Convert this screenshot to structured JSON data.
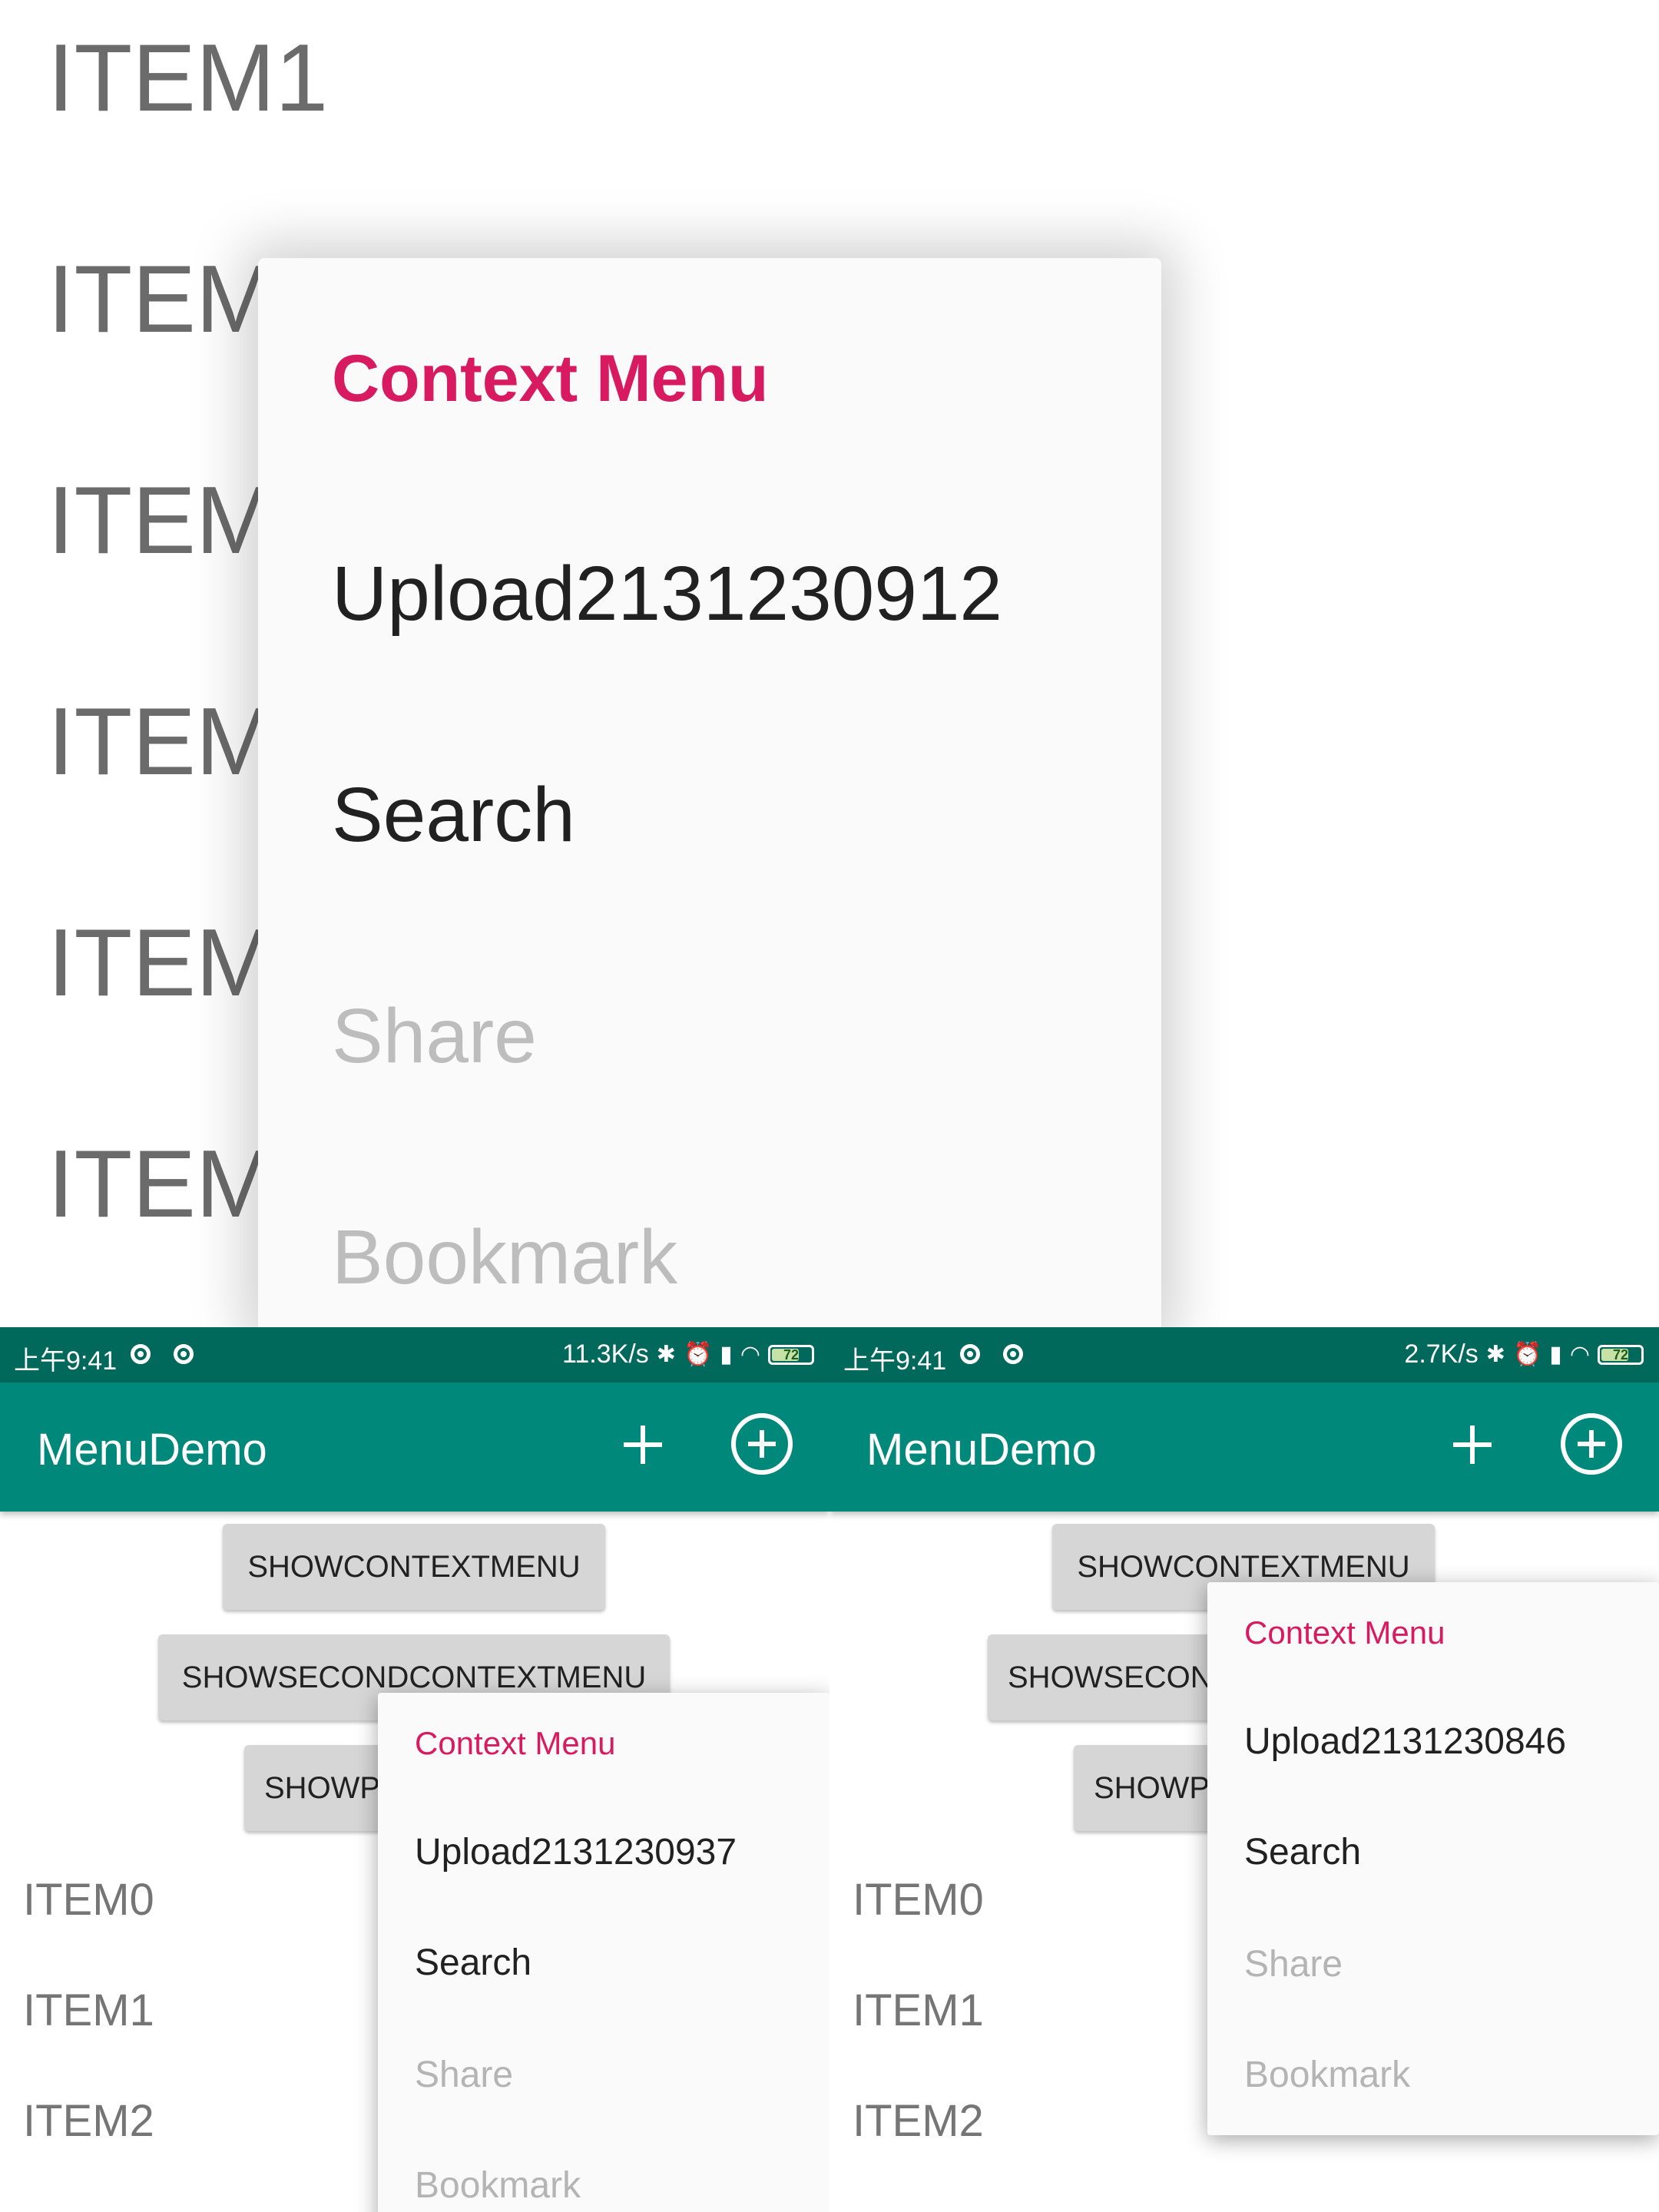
{
  "zoom": {
    "list_items": [
      "ITEM1",
      "ITEM",
      "ITEM",
      "ITEM",
      "ITEM",
      "ITEM"
    ],
    "menu": {
      "title": "Context Menu",
      "items": [
        "Upload2131230912",
        "Search",
        "Share",
        "Bookmark"
      ]
    }
  },
  "left": {
    "status": {
      "time": "上午9:41",
      "speed": "11.3K/s",
      "battery": "72"
    },
    "app_title": "MenuDemo",
    "buttons": [
      "SHOWCONTEXTMENU",
      "SHOWSECONDCONTEXTMENU",
      "SHOWP"
    ],
    "list_items": [
      "ITEM0",
      "ITEM1",
      "ITEM2"
    ],
    "menu": {
      "title": "Context Menu",
      "items": [
        "Upload2131230937",
        "Search",
        "Share",
        "Bookmark"
      ]
    }
  },
  "right": {
    "status": {
      "time": "上午9:41",
      "speed": "2.7K/s",
      "battery": "72"
    },
    "app_title": "MenuDemo",
    "buttons": [
      "SHOWCONTEXTMENU",
      "SHOWSECON",
      "SHOWP"
    ],
    "list_items": [
      "ITEM0",
      "ITEM1",
      "ITEM2"
    ],
    "menu": {
      "title": "Context Menu",
      "items": [
        "Upload2131230846",
        "Search",
        "Share",
        "Bookmark"
      ]
    }
  },
  "colors": {
    "status_bar": "#00695c",
    "app_bar": "#00897b",
    "menu_title": "#d81b60"
  },
  "icons": [
    "bluetooth-icon",
    "alarm-icon",
    "signal-icon",
    "wifi-icon",
    "battery-icon",
    "add-icon",
    "add-circle-icon"
  ]
}
